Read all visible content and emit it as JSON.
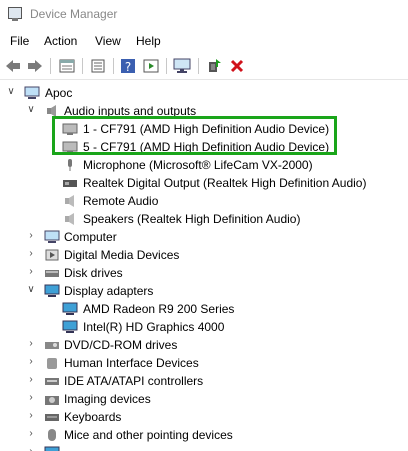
{
  "window": {
    "title": "Device Manager"
  },
  "menu": [
    "File",
    "Action",
    "View",
    "Help"
  ],
  "toolbar": [
    "back-arrow-icon",
    "forward-arrow-icon",
    "properties-icon",
    "list-icon",
    "help-icon",
    "view-icon",
    "monitor-icon",
    "update-driver-icon",
    "uninstall-icon"
  ],
  "tree": {
    "root": "Apoc",
    "category_audio": "Audio inputs and outputs",
    "audio_items": [
      "1 - CF791 (AMD High Definition Audio Device)",
      "5 - CF791 (AMD High Definition Audio Device)",
      "Microphone (Microsoft® LifeCam VX-2000)",
      "Realtek Digital Output (Realtek High Definition Audio)",
      "Remote Audio",
      "Speakers (Realtek High Definition Audio)"
    ],
    "category_computer": "Computer",
    "category_digital_media": "Digital Media Devices",
    "category_disk": "Disk drives",
    "category_display": "Display adapters",
    "display_items": [
      "AMD Radeon R9 200 Series",
      "Intel(R) HD Graphics 4000"
    ],
    "category_dvd": "DVD/CD-ROM drives",
    "category_hid": "Human Interface Devices",
    "category_ide": "IDE ATA/ATAPI controllers",
    "category_imaging": "Imaging devices",
    "category_keyboards": "Keyboards",
    "category_mice": "Mice and other pointing devices"
  },
  "highlight_color": "#1aa51a"
}
